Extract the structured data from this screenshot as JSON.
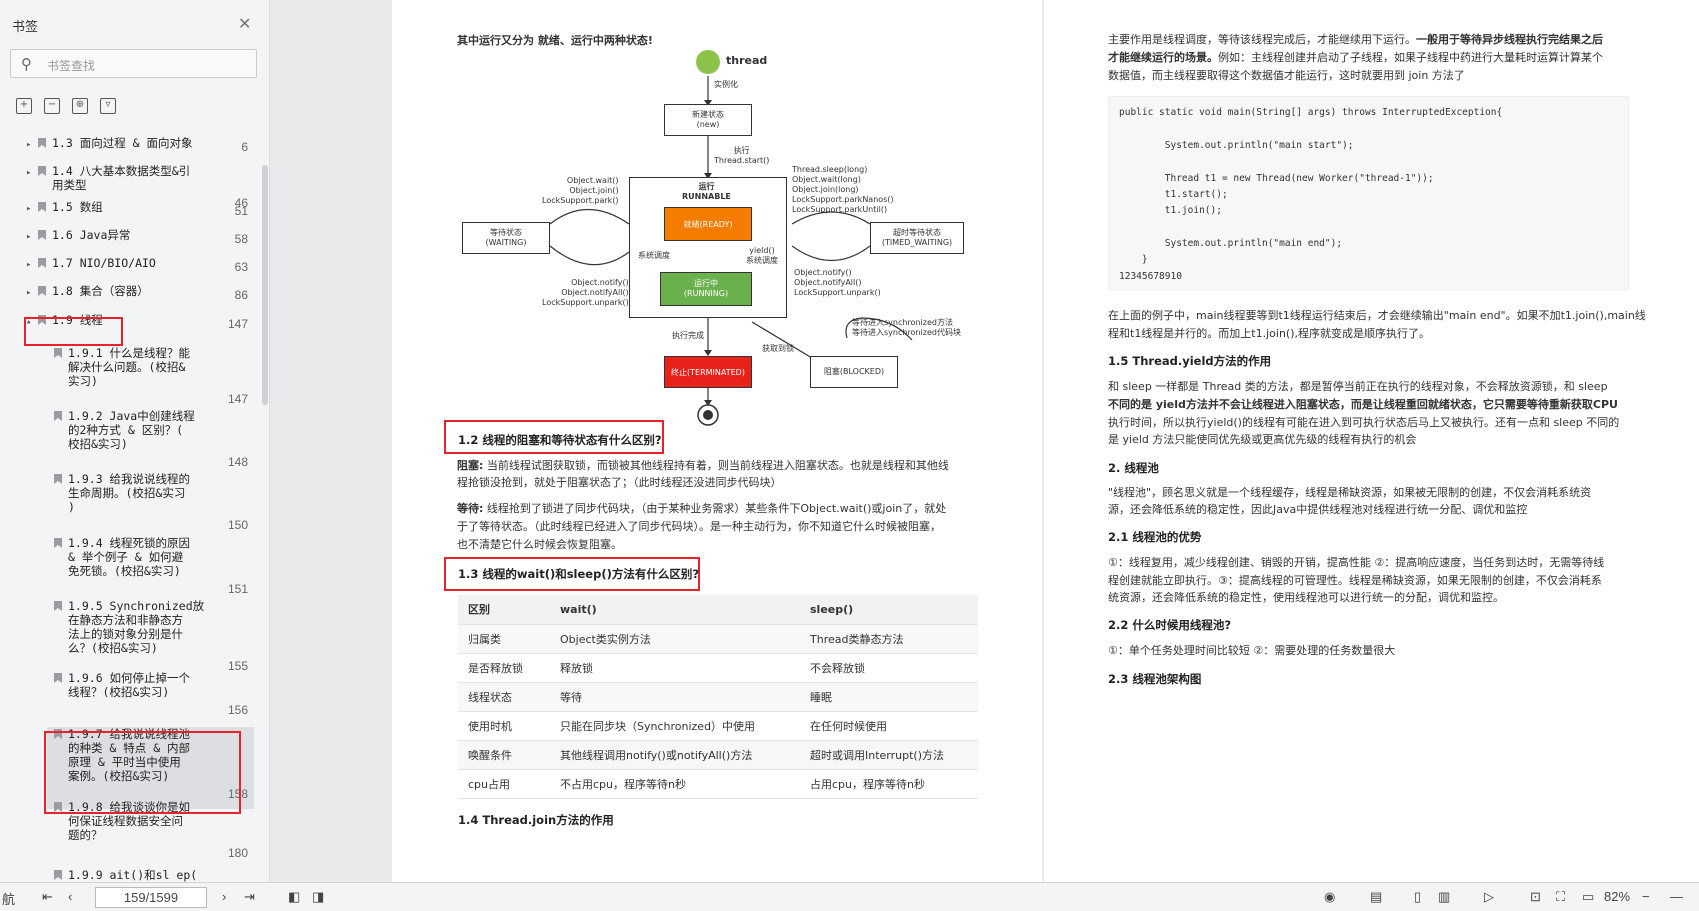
{
  "sidebar": {
    "title": "书签",
    "search_placeholder": "书签查找",
    "items": [
      {
        "label": "1.3 面向过程 & 面向对象",
        "page": "6"
      },
      {
        "label": "1.4 八大基本数据类型&引\n用类型",
        "page": "46"
      },
      {
        "label": "1.5 数组",
        "page": "51"
      },
      {
        "label": "1.6 Java异常",
        "page": "58"
      },
      {
        "label": "1.7 NIO/BIO/AIO",
        "page": "63"
      },
      {
        "label": "1.8 集合（容器）",
        "page": "86"
      },
      {
        "label": "1.9 线程",
        "page": "147"
      },
      {
        "label": "1.9.1 什么是线程？能\n解决什么问题。(校招&\n实习)",
        "page": "147"
      },
      {
        "label": "1.9.2 Java中创建线程\n的2种方式 & 区别？(\n校招&实习)",
        "page": "148"
      },
      {
        "label": "1.9.3 给我说说线程的\n生命周期。(校招&实习\n)",
        "page": "150"
      },
      {
        "label": "1.9.4 线程死锁的原因\n& 举个例子 & 如何避\n免死锁。(校招&实习)",
        "page": "151"
      },
      {
        "label": "1.9.5 Synchronized放\n在静态方法和非静态方\n法上的锁对象分别是什\n么？(校招&实习)",
        "page": "155"
      },
      {
        "label": "1.9.6 如何停止掉一个\n线程？(校招&实习)",
        "page": "156"
      },
      {
        "label": "1.9.7 给我说说线程池\n的种类 & 特点 & 内部\n原理 & 平时当中使用\n案例。(校招&实习)",
        "page": "158"
      },
      {
        "label": "1.9.8 给我谈谈你是如\n何保证线程数据安全问\n题的？",
        "page": "180"
      },
      {
        "label": "1.9.9 ait()和sl ep(",
        "page": ""
      }
    ]
  },
  "bottom": {
    "nav_label": "航",
    "page_field": "159/1599",
    "zoom": "82%"
  },
  "page1": {
    "intro": "其中运行又分为 就绪、运行中两种状态!",
    "diagram": {
      "thread": "thread",
      "instantiate": "实例化",
      "new": "新建状态\n(new)",
      "start": "执行\nThread.start()",
      "runnable": "运行\nRUNNABLE",
      "ready": "就绪(READY)",
      "running": "运行中\n(RUNNING)",
      "sched": "系统调度",
      "yield": "yield()\n系统调度",
      "waiting": "等待状态\n(WAITING)",
      "timed_waiting": "超时等待状态\n(TIMED_WAITING)",
      "wait_in": "Object.wait()\nObject.join()\nLockSupport.park()",
      "wait_out": "Object.notify()\nObject.notifyAll()\nLockSupport.unpark()",
      "timed_in": "Thread.sleep(long)\nObject.wait(long)\nObject.join(long)\nLockSupport.parkNanos()\nLockSupport.parkUntil()",
      "timed_out": "Object.notify()\nObject.notifyAll()\nLockSupport.unpark()",
      "done": "执行完成",
      "terminated": "终止(TERMINATED)",
      "blocked": "阻塞(BLOCKED)",
      "get_lock": "获取到锁",
      "wait_sync": "等待进入synchronized方法\n等待进入synchronized代码块"
    },
    "h12": "1.2 线程的阻塞和等待状态有什么区别?",
    "block_label": "阻塞:",
    "block_text": "当前线程试图获取锁，而锁被其他线程持有着，则当前线程进入阻塞状态。也就是线程和其他线",
    "block_text2": "程抢锁没抢到，就处于阻塞状态了；（此时线程还没进同步代码块）",
    "wait_label": "等待:",
    "wait_text": "线程抢到了锁进了同步代码块，（由于某种业务需求）某些条件下Object.wait()或join了，就处",
    "wait_text2": "于了等待状态。（此时线程已经进入了同步代码块）。是一种主动行为，你不知道它什么时候被阻塞，",
    "wait_text3": "也不清楚它什么时候会恢复阻塞。",
    "h13": "1.3 线程的wait()和sleep()方法有什么区别?",
    "table": [
      [
        "区别",
        "wait()",
        "sleep()"
      ],
      [
        "归属类",
        "Object类实例方法",
        "Thread类静态方法"
      ],
      [
        "是否释放锁",
        "释放锁",
        "不会释放锁"
      ],
      [
        "线程状态",
        "等待",
        "睡眠"
      ],
      [
        "使用时机",
        "只能在同步块（Synchronized）中使用",
        "在任何时候使用"
      ],
      [
        "唤醒条件",
        "其他线程调用notify()或notifyAll()方法",
        "超时或调用Interrupt()方法"
      ],
      [
        "cpu占用",
        "不占用cpu，程序等待n秒",
        "占用cpu，程序等待n秒"
      ]
    ],
    "h14": "1.4 Thread.join方法的作用"
  },
  "page2": {
    "p1a": "主要作用是线程调度，等待该线程完成后，才能继续用下运行。",
    "p1b": "一般用于等待异步线程执行完结果之后",
    "p1c": "才能继续运行的场景。",
    "p1d": "例如：主线程创建并启动了子线程，如果子线程中药进行大量耗时运算计算某个",
    "p1e": "数据值，而主线程要取得这个数据值才能运行，这时就要用到 join 方法了",
    "code": [
      "public static void main(String[] args) throws InterruptedException{",
      "        System.out.println(\"main start\");",
      "        Thread t1 = new Thread(new Worker(\"thread-1\"));",
      "        t1.start();",
      "        t1.join();",
      "        System.out.println(\"main end\");",
      "    }",
      "12345678910"
    ],
    "p2a": "在上面的例子中，main线程要等到t1线程运行结束后，才会继续输出\"main end\"。如果不加t1.join(),main线",
    "p2b": "程和t1线程是并行的。而加上t1.join(),程序就变成是顺序执行了。",
    "h15": "1.5 Thread.yield方法的作用",
    "p3a": "和 sleep 一样都是 Thread 类的方法，都是暂停当前正在执行的线程对象，不会释放资源锁，和 sleep",
    "p3b": "不同的是 yield方法并不会让线程进入阻塞状态，而是让线程重回就绪状态，它只需要等待重新获取CPU",
    "p3c": "执行时间，所以执行yield()的线程有可能在进入到可执行状态后马上又被执行。还有一点和 sleep 不同的",
    "p3d": "是 yield 方法只能使同优先级或更高优先级的线程有执行的机会",
    "h2": "2. 线程池",
    "p4a": "\"线程池\"，顾名思义就是一个线程缓存，线程是稀缺资源，如果被无限制的创建，不仅会消耗系统资",
    "p4b": "源，还会降低系统的稳定性，因此Java中提供线程池对线程进行统一分配、调优和监控",
    "h21": "2.1 线程池的优势",
    "p5a": "①：线程复用，减少线程创建、销毁的开销，提高性能 ②：提高响应速度，当任务到达时，无需等待线",
    "p5b": "程创建就能立即执行。③：提高线程的可管理性。线程是稀缺资源，如果无限制的创建，不仅会消耗系",
    "p5c": "统资源，还会降低系统的稳定性，使用线程池可以进行统一的分配，调优和监控。",
    "h22": "2.2 什么时候用线程池?",
    "p6": "①：单个任务处理时间比较短 ②：需要处理的任务数量很大",
    "h23": "2.3 线程池架构图"
  }
}
